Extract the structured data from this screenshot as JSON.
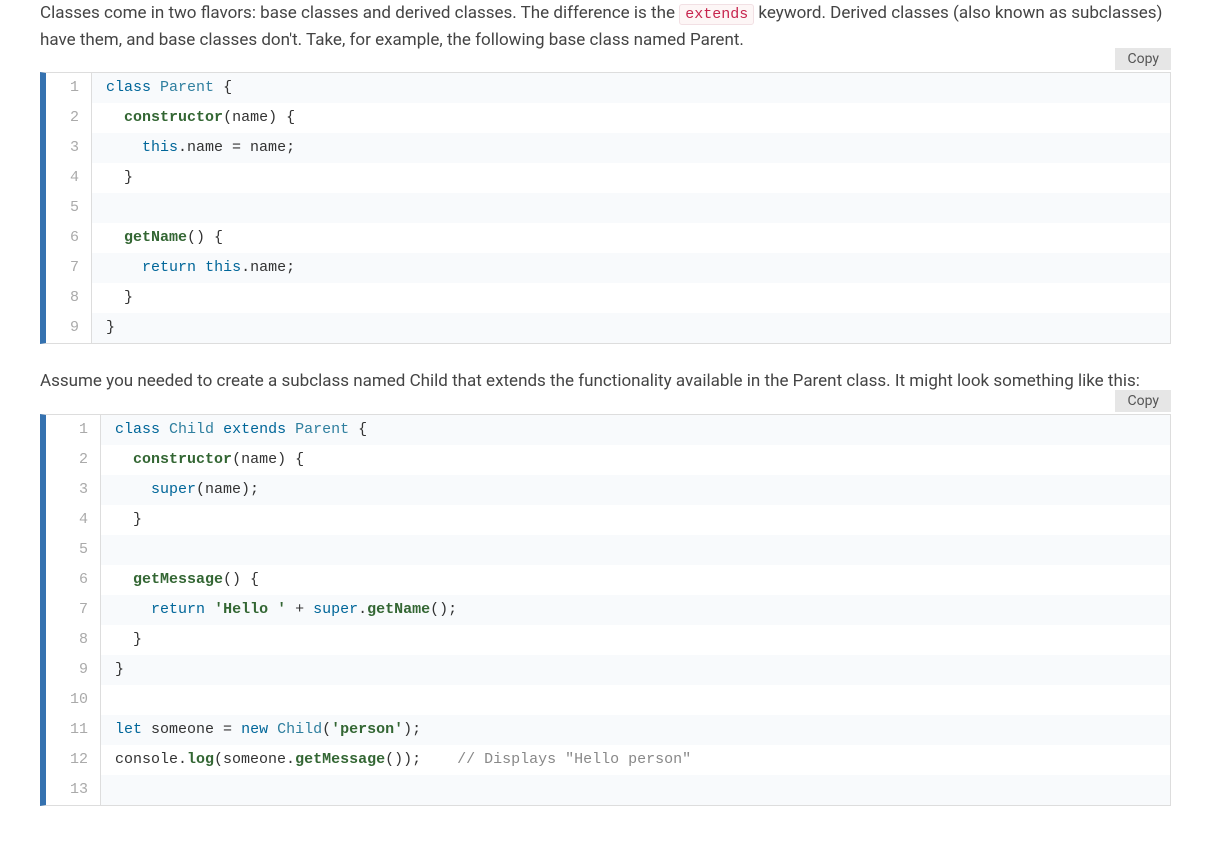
{
  "para1_pre": "Classes come in two flavors: base classes and derived classes. The difference is the ",
  "para1_code": "extends",
  "para1_post": " keyword. Derived classes (also known as subclasses) have them, and base classes don't. Take, for example, the following base class named Parent.",
  "para2": "Assume you needed to create a subclass named Child that extends the functionality available in the Parent class. It might look something like this:",
  "copy_label": "Copy",
  "block1": {
    "lines": [
      [
        {
          "t": "kw",
          "v": "class"
        },
        {
          "t": "txt",
          "v": " "
        },
        {
          "t": "type",
          "v": "Parent"
        },
        {
          "t": "txt",
          "v": " {"
        }
      ],
      [
        {
          "t": "txt",
          "v": "  "
        },
        {
          "t": "fn",
          "v": "constructor"
        },
        {
          "t": "txt",
          "v": "(name) {"
        }
      ],
      [
        {
          "t": "txt",
          "v": "    "
        },
        {
          "t": "kw",
          "v": "this"
        },
        {
          "t": "txt",
          "v": ".name = name;"
        }
      ],
      [
        {
          "t": "txt",
          "v": "  }"
        }
      ],
      [],
      [
        {
          "t": "txt",
          "v": "  "
        },
        {
          "t": "fn",
          "v": "getName"
        },
        {
          "t": "txt",
          "v": "() {"
        }
      ],
      [
        {
          "t": "txt",
          "v": "    "
        },
        {
          "t": "kw",
          "v": "return"
        },
        {
          "t": "txt",
          "v": " "
        },
        {
          "t": "kw",
          "v": "this"
        },
        {
          "t": "txt",
          "v": ".name;"
        }
      ],
      [
        {
          "t": "txt",
          "v": "  }"
        }
      ],
      [
        {
          "t": "txt",
          "v": "}"
        }
      ]
    ]
  },
  "block2": {
    "lines": [
      [
        {
          "t": "kw",
          "v": "class"
        },
        {
          "t": "txt",
          "v": " "
        },
        {
          "t": "type",
          "v": "Child"
        },
        {
          "t": "txt",
          "v": " "
        },
        {
          "t": "kw",
          "v": "extends"
        },
        {
          "t": "txt",
          "v": " "
        },
        {
          "t": "type",
          "v": "Parent"
        },
        {
          "t": "txt",
          "v": " {"
        }
      ],
      [
        {
          "t": "txt",
          "v": "  "
        },
        {
          "t": "fn",
          "v": "constructor"
        },
        {
          "t": "txt",
          "v": "(name) {"
        }
      ],
      [
        {
          "t": "txt",
          "v": "    "
        },
        {
          "t": "kw",
          "v": "super"
        },
        {
          "t": "txt",
          "v": "(name);"
        }
      ],
      [
        {
          "t": "txt",
          "v": "  }"
        }
      ],
      [],
      [
        {
          "t": "txt",
          "v": "  "
        },
        {
          "t": "fn",
          "v": "getMessage"
        },
        {
          "t": "txt",
          "v": "() {"
        }
      ],
      [
        {
          "t": "txt",
          "v": "    "
        },
        {
          "t": "kw",
          "v": "return"
        },
        {
          "t": "txt",
          "v": " "
        },
        {
          "t": "str",
          "v": "'Hello '"
        },
        {
          "t": "txt",
          "v": " + "
        },
        {
          "t": "kw",
          "v": "super"
        },
        {
          "t": "txt",
          "v": "."
        },
        {
          "t": "fn",
          "v": "getName"
        },
        {
          "t": "txt",
          "v": "();"
        }
      ],
      [
        {
          "t": "txt",
          "v": "  }"
        }
      ],
      [
        {
          "t": "txt",
          "v": "}"
        }
      ],
      [],
      [
        {
          "t": "kw",
          "v": "let"
        },
        {
          "t": "txt",
          "v": " someone = "
        },
        {
          "t": "kw",
          "v": "new"
        },
        {
          "t": "txt",
          "v": " "
        },
        {
          "t": "type",
          "v": "Child"
        },
        {
          "t": "txt",
          "v": "("
        },
        {
          "t": "str",
          "v": "'person'"
        },
        {
          "t": "txt",
          "v": ");"
        }
      ],
      [
        {
          "t": "txt",
          "v": "console."
        },
        {
          "t": "fn",
          "v": "log"
        },
        {
          "t": "txt",
          "v": "(someone."
        },
        {
          "t": "fn",
          "v": "getMessage"
        },
        {
          "t": "txt",
          "v": "());    "
        },
        {
          "t": "cm",
          "v": "// Displays \"Hello person\""
        }
      ],
      []
    ]
  }
}
